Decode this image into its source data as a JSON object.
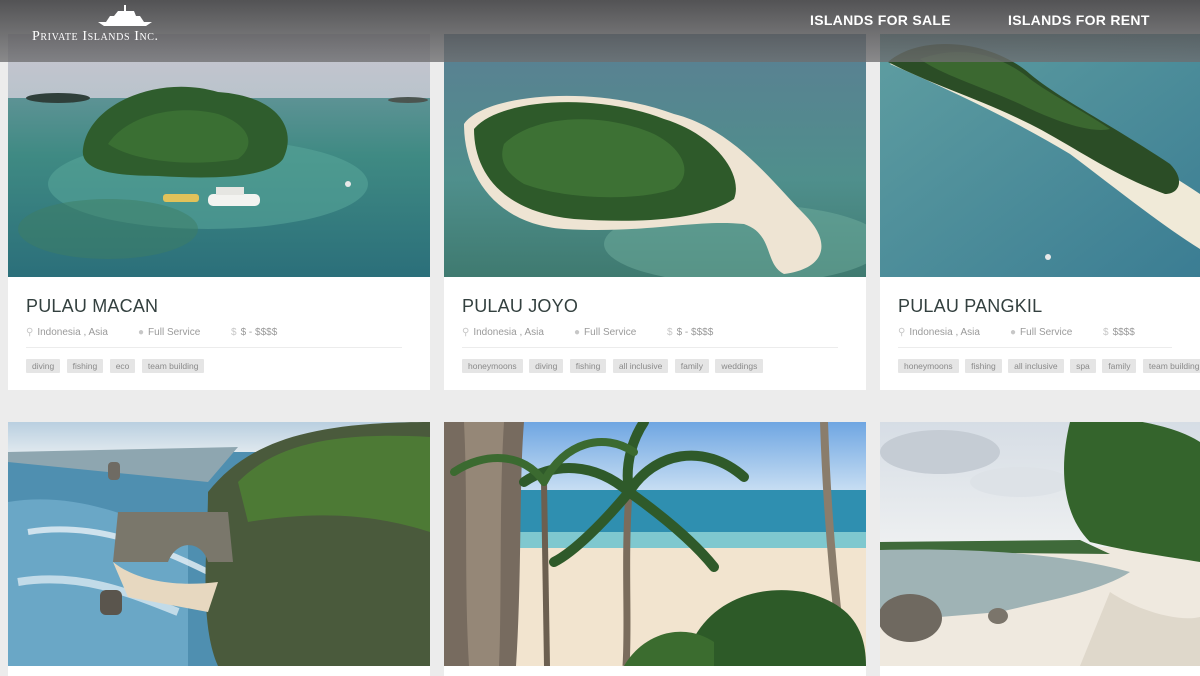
{
  "brand": {
    "logo_text": "Private Islands Inc."
  },
  "nav": {
    "for_sale": "ISLANDS FOR SALE",
    "for_rent": "ISLANDS FOR RENT"
  },
  "listings": [
    {
      "name": "PULAU MACAN",
      "location": "Indonesia , Asia",
      "service": "Full Service",
      "price": "$ - $$$$",
      "tags": [
        "diving",
        "fishing",
        "eco",
        "team building"
      ]
    },
    {
      "name": "PULAU JOYO",
      "location": "Indonesia , Asia",
      "service": "Full Service",
      "price": "$ - $$$$",
      "tags": [
        "honeymoons",
        "diving",
        "fishing",
        "all inclusive",
        "family",
        "weddings"
      ]
    },
    {
      "name": "PULAU PANGKIL",
      "location": "Indonesia , Asia",
      "service": "Full Service",
      "price": "$$$$",
      "tags": [
        "honeymoons",
        "fishing",
        "all inclusive",
        "spa",
        "family",
        "team building"
      ]
    }
  ],
  "colors": {
    "header_bg": "#5a5a5c",
    "title_text": "#33403f",
    "tag_bg": "#e5e5e5"
  }
}
